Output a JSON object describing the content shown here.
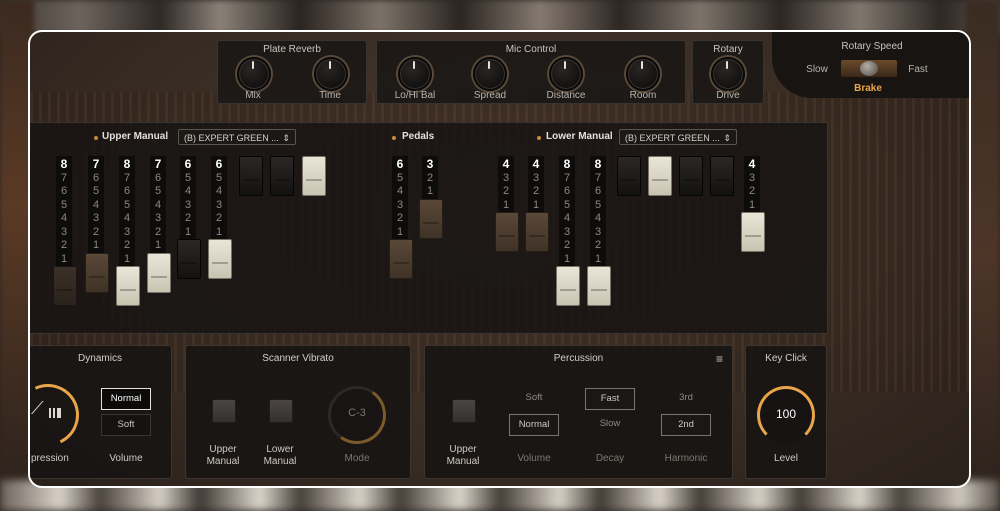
{
  "plate_reverb": {
    "title": "Plate Reverb",
    "knobs": [
      "Mix",
      "Time"
    ]
  },
  "mic_control": {
    "title": "Mic Control",
    "knobs": [
      "Lo/Hi Bal",
      "Spread",
      "Distance",
      "Room"
    ]
  },
  "rotary": {
    "title": "Rotary",
    "knob": "Drive"
  },
  "rotary_speed": {
    "title": "Rotary Speed",
    "slow": "Slow",
    "fast": "Fast",
    "brake": "Brake"
  },
  "upper_manual": {
    "title": "Upper Manual",
    "preset": "(B) EXPERT GREEN ...",
    "drawbars": [
      {
        "nums": [
          "8",
          "7",
          "6",
          "5",
          "4",
          "3",
          "2",
          "1"
        ],
        "style": "dark",
        "level": 8
      },
      {
        "nums": [
          "7",
          "6",
          "5",
          "4",
          "3",
          "2",
          "1"
        ],
        "style": "brown",
        "level": 7
      },
      {
        "nums": [
          "8",
          "7",
          "6",
          "5",
          "4",
          "3",
          "2",
          "1"
        ],
        "style": "cream",
        "level": 6
      },
      {
        "nums": [
          "7",
          "6",
          "5",
          "4",
          "3",
          "2",
          "1"
        ],
        "style": "cream",
        "level": 5
      },
      {
        "nums": [
          "6",
          "5",
          "4",
          "3",
          "2",
          "1"
        ],
        "style": "black",
        "level": 6
      },
      {
        "nums": [
          "6",
          "5",
          "4",
          "3",
          "2",
          "1"
        ],
        "style": "cream",
        "level": 5
      },
      {
        "nums": [],
        "style": "black",
        "level": 0
      },
      {
        "nums": [],
        "style": "black",
        "level": 0
      },
      {
        "nums": [],
        "style": "cream",
        "level": 0
      }
    ]
  },
  "pedals": {
    "title": "Pedals",
    "drawbars": [
      {
        "nums": [
          "6",
          "5",
          "4",
          "3",
          "2",
          "1"
        ],
        "style": "brown",
        "level": 6
      },
      {
        "nums": [
          "3",
          "2",
          "1"
        ],
        "style": "brown",
        "level": 3
      }
    ]
  },
  "lower_manual": {
    "title": "Lower Manual",
    "preset": "(B) EXPERT GREEN ...",
    "drawbars": [
      {
        "nums": [
          "4",
          "3",
          "2",
          "1"
        ],
        "style": "brown",
        "level": 4
      },
      {
        "nums": [
          "4",
          "3",
          "2",
          "1"
        ],
        "style": "brown",
        "level": 4
      },
      {
        "nums": [
          "8",
          "7",
          "6",
          "5",
          "4",
          "3",
          "2",
          "1"
        ],
        "style": "cream",
        "level": 8
      },
      {
        "nums": [
          "8",
          "7",
          "6",
          "5",
          "4",
          "3",
          "2",
          "1"
        ],
        "style": "cream",
        "level": 8
      },
      {
        "nums": [],
        "style": "black",
        "level": 0
      },
      {
        "nums": [],
        "style": "cream",
        "level": 0
      },
      {
        "nums": [],
        "style": "black",
        "level": 0
      },
      {
        "nums": [],
        "style": "black",
        "level": 0
      },
      {
        "nums": [
          "4",
          "3",
          "2",
          "1"
        ],
        "style": "cream",
        "level": 4
      }
    ]
  },
  "dynamics": {
    "title": "Dynamics",
    "expression": "pression",
    "volume_label": "Volume",
    "options": [
      "Normal",
      "Soft"
    ],
    "selected": "Normal"
  },
  "scanner_vibrato": {
    "title": "Scanner Vibrato",
    "upper": [
      "Upper",
      "Manual"
    ],
    "lower": [
      "Lower",
      "Manual"
    ],
    "mode_value": "C-3",
    "mode_label": "Mode"
  },
  "percussion": {
    "title": "Percussion",
    "menu_icon": "menu-icon",
    "upper": [
      "Upper",
      "Manual"
    ],
    "volume": {
      "label": "Volume",
      "options": [
        "Soft",
        "Normal"
      ],
      "selected": "Normal"
    },
    "decay": {
      "label": "Decay",
      "options": [
        "Fast",
        "Slow"
      ],
      "selected": "Fast"
    },
    "harmonic": {
      "label": "Harmonic",
      "options": [
        "3rd",
        "2nd"
      ],
      "selected": "2nd"
    }
  },
  "key_click": {
    "title": "Key Click",
    "value": "100",
    "label": "Level"
  },
  "colors": {
    "accent": "#e9a54a",
    "cream": "#eae6d8",
    "panel": "#1b1816"
  }
}
